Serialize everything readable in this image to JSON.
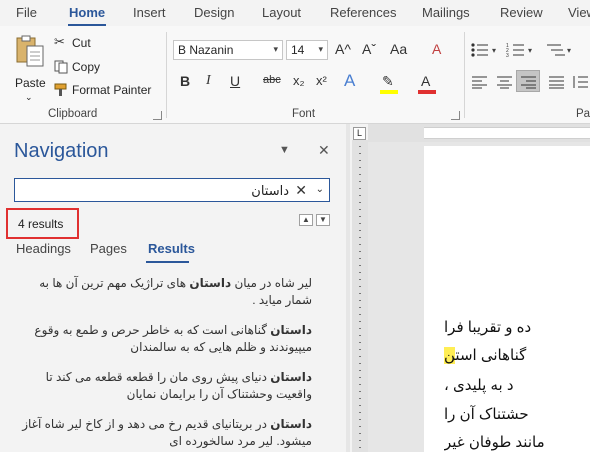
{
  "ribbon_tabs": [
    "File",
    "Home",
    "Insert",
    "Design",
    "Layout",
    "References",
    "Mailings",
    "Review",
    "View"
  ],
  "clipboard": {
    "paste": "Paste",
    "cut": "Cut",
    "copy": "Copy",
    "format_painter": "Format Painter",
    "group_label": "Clipboard"
  },
  "font": {
    "name": "B Nazanin",
    "size": "14",
    "group_label": "Font",
    "grow": "A^",
    "shrink": "Aˇ",
    "change_case": "Aa",
    "clear": "A",
    "bold": "B",
    "italic": "I",
    "underline": "U",
    "strike": "abc",
    "subscript": "x₂",
    "superscript": "x²",
    "text_effects": "A",
    "highlight": "✎",
    "font_color": "A",
    "highlight_color": "#ffff00",
    "font_color_bar": "#e03030"
  },
  "paragraph": {
    "group_label": "Pa"
  },
  "navigation": {
    "title": "Navigation",
    "search_value": "داستان",
    "results_count": "4 results",
    "tabs": [
      "Headings",
      "Pages",
      "Results"
    ],
    "active_tab": "Results",
    "results": [
      {
        "before": "لیر شاه در میان ",
        "term": "داستان",
        "after": " های تراژیک مهم ترین آن ها به شمار میاید ."
      },
      {
        "before": "",
        "term": "داستان",
        "after": " گناهانی است که به خاطر حرص و طمع به وقوع میپیوندند و ظلم هایی که به سالمندان"
      },
      {
        "before": "",
        "term": "داستان",
        "after": " دنیای پیش روی مان را قطعه قطعه می کند تا واقعیت وحشتناک آن را برایمان نمایان"
      },
      {
        "before": "",
        "term": "داستان",
        "after": " در بریتانیای قدیم رخ می دهد و از کاخ لیر شاه آغاز میشود. لیر مرد سالخورده ای"
      }
    ]
  },
  "document": {
    "lines": [
      {
        "text": "ده و تقریبا فرا",
        "highlight": ""
      },
      {
        "text": " گناهانی است",
        "highlight": "ن"
      },
      {
        "text": "د به پلیدی ،",
        "highlight": ""
      },
      {
        "text": "حشتناک آن را",
        "highlight": ""
      },
      {
        "text": " مانند طوفان غیر",
        "highlight": ""
      }
    ]
  },
  "colors": {
    "accent": "#2b579a",
    "results_box": "#e03030"
  }
}
